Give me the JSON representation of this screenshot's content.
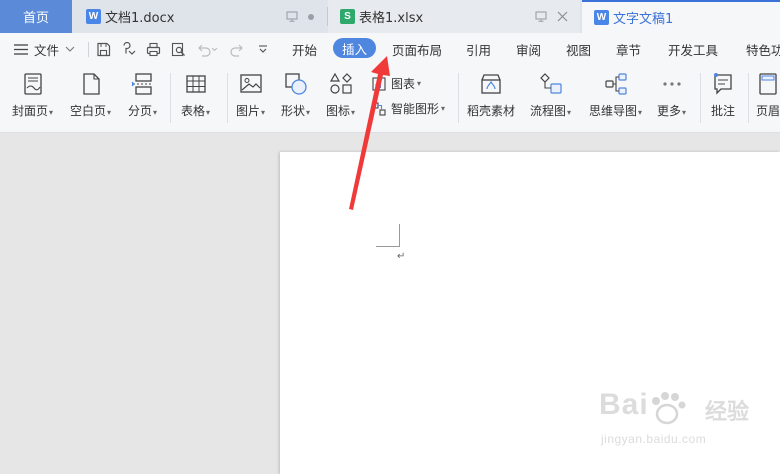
{
  "tabs": {
    "home": "首页",
    "doc1": "文档1.docx",
    "sheet1": "表格1.xlsx",
    "doc_active": "文字文稿1",
    "doc_letter": "W",
    "sheet_letter": "S"
  },
  "menu": {
    "file": "文件",
    "items": [
      "开始",
      "插入",
      "页面布局",
      "引用",
      "审阅",
      "视图",
      "章节",
      "开发工具",
      "特色功"
    ],
    "active": "插入"
  },
  "ribbon": {
    "cover": "封面页",
    "blank": "空白页",
    "page_break": "分页",
    "table": "表格",
    "picture": "图片",
    "shape": "形状",
    "icons": "图标",
    "chart": "图表",
    "smart_shape": "智能图形",
    "material": "稻壳素材",
    "flowchart": "流程图",
    "mindmap": "思维导图",
    "more": "更多",
    "comment": "批注",
    "header": "页眉"
  },
  "watermark": {
    "brand": "Bai",
    "brand_suffix": "经验",
    "url": "jingyan.baidu.com"
  },
  "colors": {
    "accent": "#4f86e0",
    "home_tab": "#5b8bd8",
    "arrow": "#f03a3a"
  }
}
